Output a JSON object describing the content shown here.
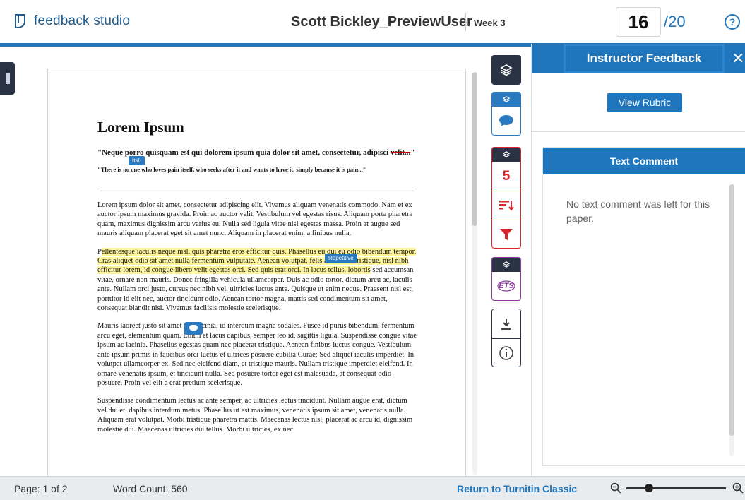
{
  "header": {
    "logo_text": "feedback studio",
    "student_name": "Scott Bickley_PreviewUser",
    "assignment": "Week 3",
    "score": "16",
    "score_total": "/20",
    "help_label": "?"
  },
  "document": {
    "title": "Lorem Ipsum",
    "quote1_start": "\"Neque porro quisquam est qui dolorem ipsum quia dolor sit amet, consectetur, adipisci ",
    "quote1_strike": "velit...",
    "quote1_end": "\"",
    "quote2": "\"There is no one who loves pain itself, who seeks after it and wants to have it, simply because it is pain...\"",
    "para1": "Lorem ipsum dolor sit amet, consectetur adipiscing elit. Vivamus aliquam venenatis commodo. Nam et ex auctor ipsum maximus gravida. Proin ac auctor velit. Vestibulum vel egestas risus. Aliquam porta pharetra quam, maximus dignissim arcu varius eu. Nulla sed ligula vitae nisi egestas massa. Proin at augue sed mauris aliquam placerat eget sit amet nunc. Aliquam in placerat enim, a finibus nulla.",
    "para2_start": "P",
    "para2_highlight": "ellentesque iaculis neque nisl, quis pharetra eros efficitur quis. Phasellus eu dui eu odio bibendum tempor. Cras aliquet odio sit amet nulla fermentum vulputate. Aenean volutpat, felis ac rutrum tristique, nisl nibh efficitur lorem, id congue libero velit egestas orci. Sed quis erat orci. In lacus tellus, lobortis",
    "para2_end": " sed accumsan vitae, ornare non mauris. Donec fringilla vehicula ullamcorper. Duis ac odio tortor, dictum arcu ac, iaculis ante. Nullam orci justo, cursus nec nibh vel, ultricies luctus ante. Quisque ut enim neque. Praesent nisl est, porttitor id elit nec, auctor tincidunt odio. Aenean tortor magna, mattis sed condimentum sit amet, consequat blandit nisi. Vivamus facilisis molestie scelerisque.",
    "para3": "Mauris laoreet justo sit amet nisi lacinia, id interdum magna sodales. Fusce id purus bibendum, fermentum arcu eget, elementum quam. Etiam et lacus dapibus, semper leo id, sagittis ligula. Suspendisse congue vitae ipsum ac lacinia. Phasellus egestas quam nec placerat tristique. Aenean finibus luctus congue. Vestibulum ante ipsum primis in faucibus orci luctus et ultrices posuere cubilia Curae; Sed aliquet iaculis imperdiet. In volutpat ullamcorper ex. Sed nec eleifend diam, et tristique mauris. Nullam tristique imperdiet eleifend. In ornare venenatis ipsum, et tincidunt nulla. Sed posuere tortor eget est malesuada, at consequat odio posuere. Proin vel elit a erat pretium scelerisque.",
    "para4": "Suspendisse condimentum lectus ac ante semper, ac ultricies lectus tincidunt. Nullam augue erat, dictum vel dui et, dapibus interdum metus. Phasellus ut est maximus, venenatis ipsum sit amet, venenatis nulla. Aliquam erat volutpat. Morbi tristique pharetra mattis. Maecenas lectus nisl, placerat ac arcu id, dignissim molestie dui. Maecenas ultricies dui tellus. Morbi ultricies, ex nec",
    "tag_ital": "Ital.",
    "tag_repetitive": "Repetitive"
  },
  "tools": {
    "grade_count": "5",
    "ets_label": "ETS"
  },
  "right_panel": {
    "title": "Instructor Feedback",
    "close": "✕",
    "view_rubric": "View Rubric",
    "text_comment_title": "Text Comment",
    "text_comment_body": "No text comment was left for this paper."
  },
  "footer": {
    "page": "Page: 1 of 2",
    "word_count": "Word Count: 560",
    "return_link": "Return to Turnitin Classic"
  },
  "colors": {
    "brand_blue": "#1f76bc",
    "dark_navy": "#2a3344",
    "grade_red": "#d9252b",
    "ets_purple": "#8e3aa0",
    "highlight_yellow": "#fff59d"
  }
}
